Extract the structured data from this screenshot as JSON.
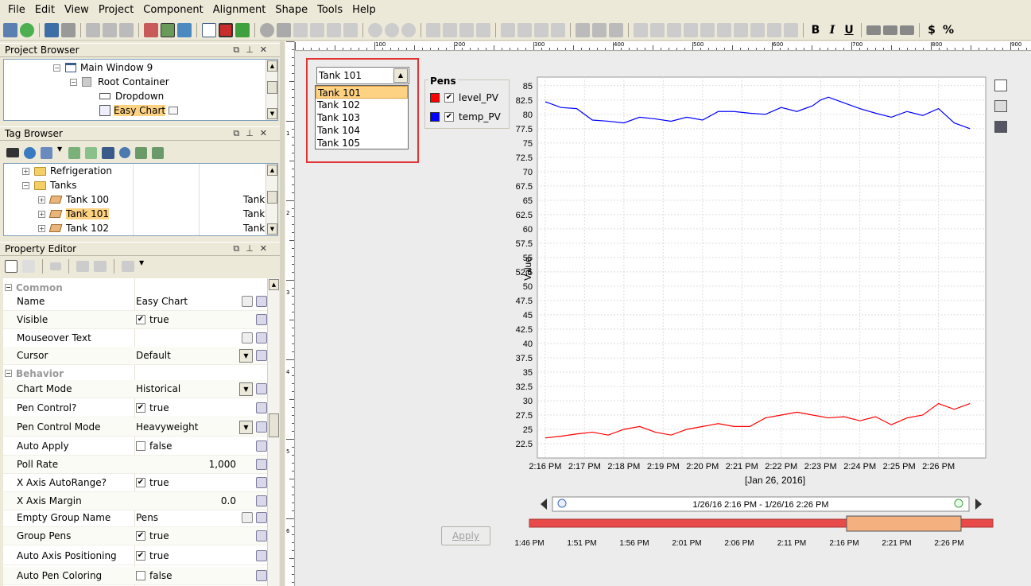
{
  "menu": [
    "File",
    "Edit",
    "View",
    "Project",
    "Component",
    "Alignment",
    "Shape",
    "Tools",
    "Help"
  ],
  "toolbar": {
    "bold": "B",
    "italic": "I",
    "underline": "U",
    "currency": "$",
    "percent": "%"
  },
  "project_browser": {
    "title": "Project Browser",
    "items": [
      {
        "label": "Main Window 9"
      },
      {
        "label": "Root Container"
      },
      {
        "label": "Dropdown"
      },
      {
        "label": "Easy Chart"
      }
    ]
  },
  "tag_browser": {
    "title": "Tag Browser",
    "items": [
      {
        "label": "Refrigeration",
        "col": ""
      },
      {
        "label": "Tanks",
        "col": ""
      },
      {
        "label": "Tank 100",
        "col": "Tank"
      },
      {
        "label": "Tank 101",
        "col": "Tank"
      },
      {
        "label": "Tank 102",
        "col": "Tank"
      }
    ]
  },
  "property_editor": {
    "title": "Property Editor",
    "rows": [
      {
        "type": "cat",
        "name": "Common"
      },
      {
        "name": "Name",
        "value": "Easy Chart"
      },
      {
        "name": "Visible",
        "value": "true",
        "check": "✔"
      },
      {
        "name": "Mouseover Text",
        "value": ""
      },
      {
        "name": "Cursor",
        "value": "Default"
      },
      {
        "type": "cat",
        "name": "Behavior"
      },
      {
        "name": "Chart Mode",
        "value": "Historical"
      },
      {
        "name": "Pen Control?",
        "value": "true",
        "check": "✔"
      },
      {
        "name": "Pen Control Mode",
        "value": "Heavyweight"
      },
      {
        "name": "Auto Apply",
        "value": "false",
        "check": ""
      },
      {
        "name": "Poll Rate",
        "value": "1,000",
        "align": "right"
      },
      {
        "name": "X Axis AutoRange?",
        "value": "true",
        "check": "✔"
      },
      {
        "name": "X Axis Margin",
        "value": "0.0",
        "align": "right"
      },
      {
        "name": "Empty Group Name",
        "value": "Pens"
      },
      {
        "name": "Group Pens",
        "value": "true",
        "check": "✔"
      },
      {
        "name": "Auto Axis Positioning",
        "value": "true",
        "check": "✔"
      },
      {
        "name": "Auto Pen Coloring",
        "value": "false",
        "check": ""
      }
    ]
  },
  "ruler": {
    "h": [
      "100",
      "200",
      "300",
      "400",
      "500",
      "600",
      "700",
      "800",
      "900"
    ],
    "v": [
      "1",
      "2",
      "3",
      "4",
      "5",
      "6"
    ]
  },
  "dropdown": {
    "value": "Tank 101",
    "options": [
      "Tank 101",
      "Tank 102",
      "Tank 103",
      "Tank 104",
      "Tank 105"
    ]
  },
  "pens": {
    "title": "Pens",
    "items": [
      {
        "label": "level_PV",
        "color": "#ff0000"
      },
      {
        "label": "temp_PV",
        "color": "#0000ff"
      }
    ]
  },
  "chart_data": {
    "type": "line",
    "ylabel": "Value",
    "xlabel": "[Jan 26, 2016]",
    "ylim": [
      20,
      86.5
    ],
    "yticks": [
      "22.5",
      "25",
      "27.5",
      "30",
      "32.5",
      "35",
      "37.5",
      "40",
      "42.5",
      "45",
      "47.5",
      "50",
      "52.5",
      "55",
      "57.5",
      "60",
      "62.5",
      "65",
      "67.5",
      "70",
      "72.5",
      "75",
      "77.5",
      "80",
      "82.5",
      "85"
    ],
    "xticks": [
      "2:16 PM",
      "2:17 PM",
      "2:18 PM",
      "2:19 PM",
      "2:20 PM",
      "2:21 PM",
      "2:22 PM",
      "2:23 PM",
      "2:24 PM",
      "2:25 PM",
      "2:26 PM"
    ],
    "series": [
      {
        "name": "temp_PV",
        "color": "#0000ff",
        "x": [
          0,
          0.4,
          0.8,
          1.2,
          1.6,
          2,
          2.4,
          2.8,
          3.2,
          3.6,
          4,
          4.4,
          4.8,
          5.2,
          5.6,
          6,
          6.4,
          6.8,
          7,
          7.2,
          7.6,
          8,
          8.4,
          8.8,
          9.2,
          9.6,
          10,
          10.4,
          10.8
        ],
        "y": [
          82.2,
          81.2,
          81,
          79,
          78.8,
          78.5,
          79.5,
          79.2,
          78.8,
          79.5,
          79,
          80.5,
          80.5,
          80.2,
          80,
          81.2,
          80.5,
          81.5,
          82.5,
          83,
          82,
          81,
          80.2,
          79.5,
          80.5,
          79.8,
          81,
          78.5,
          77.5
        ]
      },
      {
        "name": "level_PV",
        "color": "#ff0000",
        "x": [
          0,
          0.4,
          0.8,
          1.2,
          1.6,
          2,
          2.4,
          2.8,
          3.2,
          3.6,
          4,
          4.4,
          4.8,
          5.2,
          5.6,
          6,
          6.4,
          6.8,
          7.2,
          7.6,
          8,
          8.4,
          8.8,
          9.2,
          9.6,
          10,
          10.4,
          10.8
        ],
        "y": [
          23.5,
          23.8,
          24.2,
          24.5,
          24,
          25,
          25.5,
          24.5,
          24,
          25,
          25.5,
          26,
          25.5,
          25.5,
          27,
          27.5,
          28,
          27.5,
          27,
          27.2,
          26.5,
          27.2,
          25.8,
          27,
          27.5,
          29.5,
          28.5,
          29.5
        ]
      }
    ]
  },
  "time_range": {
    "label": "1/26/16 2:16 PM - 1/26/16 2:26 PM",
    "ticks": [
      "1:46 PM",
      "1:51 PM",
      "1:56 PM",
      "2:01 PM",
      "2:06 PM",
      "2:11 PM",
      "2:16 PM",
      "2:21 PM",
      "2:26 PM"
    ]
  },
  "apply_button": "Apply"
}
